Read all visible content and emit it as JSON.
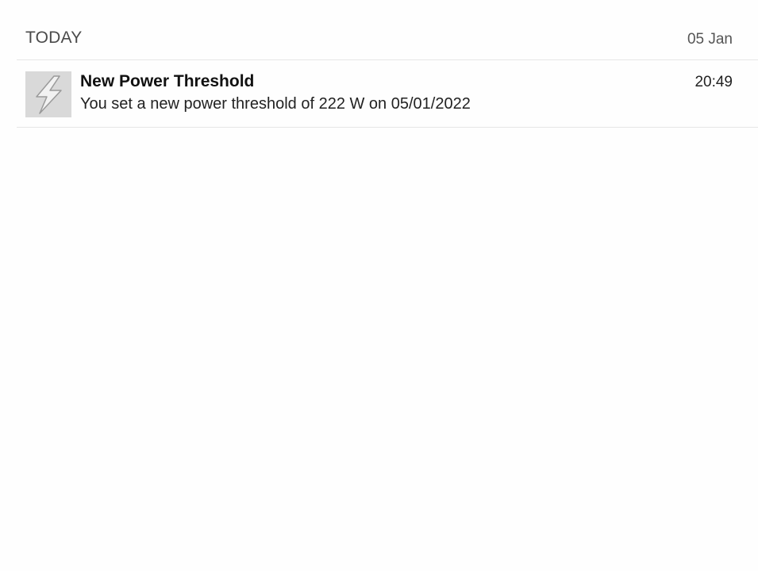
{
  "section": {
    "title": "TODAY",
    "date": "05 Jan"
  },
  "notifications": [
    {
      "icon": "lightning-bolt-icon",
      "title": "New Power Threshold",
      "time": "20:49",
      "body": "You set a new power threshold of 222 W on 05/01/2022"
    }
  ],
  "colors": {
    "background": "#fefefe",
    "divider": "#e6e6e6",
    "icon_background": "#d9d9d9",
    "header_text": "#4a4a4a"
  }
}
